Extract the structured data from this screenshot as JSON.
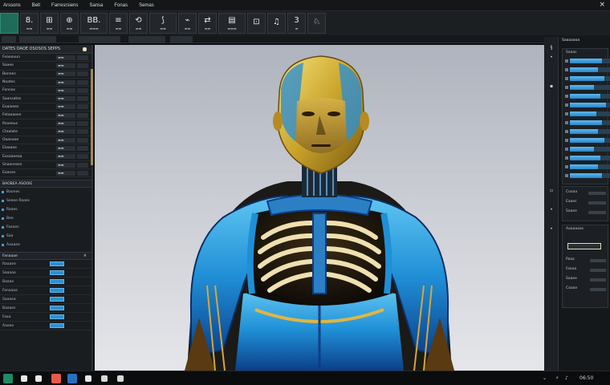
{
  "menubar": {
    "items": [
      "Arssons",
      "Belt",
      "Farresrsiens",
      "Sansa",
      "Fonas",
      "Semas"
    ],
    "close_glyph": "×"
  },
  "toolbar": {
    "tools": [
      {
        "glyph": "",
        "label": "",
        "icon": "app-logo-icon",
        "accent": true
      },
      {
        "glyph": "8.",
        "label": "▬▬",
        "icon": "number-tool-icon"
      },
      {
        "glyph": "⊞",
        "label": "▬▬",
        "icon": "grid-tool-icon"
      },
      {
        "glyph": "⊕",
        "label": "▬▬",
        "icon": "add-object-icon"
      },
      {
        "glyph": "BB.",
        "label": "▬▬▬",
        "icon": "bone-tool-icon",
        "wide": true
      },
      {
        "glyph": "≡",
        "label": "▬▬",
        "icon": "list-tool-icon"
      },
      {
        "glyph": "⟲",
        "label": "▬▬",
        "icon": "rotate-icon"
      },
      {
        "glyph": "⟆",
        "label": "▬▬",
        "icon": "curve-icon",
        "wide": true
      },
      {
        "glyph": "⌁",
        "label": "▬▬",
        "icon": "pen-icon"
      },
      {
        "glyph": "⇄",
        "label": "▬▬",
        "icon": "transfer-icon"
      },
      {
        "glyph": "▤",
        "label": "▬▬▬",
        "icon": "panel-icon",
        "wide": true
      },
      {
        "glyph": "⊡",
        "label": "",
        "icon": "frame-icon"
      },
      {
        "glyph": "♫",
        "label": "",
        "icon": "media-icon"
      },
      {
        "glyph": "3",
        "label": "▬",
        "icon": "three-icon"
      },
      {
        "glyph": "♘",
        "label": "",
        "icon": "figure-icon"
      }
    ]
  },
  "left_panel": {
    "header": "DATES  DAOE  OSOSOS  SEPPS",
    "properties": [
      {
        "name": "Feaoouun",
        "value": "▬▬"
      },
      {
        "name": "Saaee",
        "value": "▬▬"
      },
      {
        "name": "Bonnes",
        "value": "▬▬"
      },
      {
        "name": "Noates",
        "value": "▬▬"
      },
      {
        "name": "Fonnes",
        "value": "▬▬"
      },
      {
        "name": "Saansates",
        "value": "▬▬"
      },
      {
        "name": "Eoaieees",
        "value": "▬▬"
      },
      {
        "name": "Fetaoaoen",
        "value": "▬▬"
      },
      {
        "name": "Rsoeeus",
        "value": "▬▬"
      },
      {
        "name": "Ctaalate",
        "value": "▬▬"
      },
      {
        "name": "Oaaeaoe",
        "value": "▬▬"
      },
      {
        "name": "Elaaaoe",
        "value": "▬▬"
      },
      {
        "name": "Eosaaeeaa",
        "value": "▬▬"
      },
      {
        "name": "Snaoneses",
        "value": "▬▬"
      },
      {
        "name": "Eoanes",
        "value": "▬▬"
      }
    ],
    "section_title": "BAOBEA ASOOIE",
    "sub_items": [
      "Baones",
      "Seeee  Raaes",
      "Raaes",
      "Bee",
      "Faaaes",
      "Saa",
      "Aaaaee"
    ],
    "layers_title": "Fanaaae",
    "layers": [
      "Raaaee",
      "Saaaaa",
      "Baaae",
      "Fanaaaa",
      "Saaaea",
      "Baaaes",
      "Faaa",
      "Aaaee"
    ]
  },
  "right_panel": {
    "title": "Saaaaaoa",
    "top_label": "Saaas",
    "sliders": [
      0.8,
      0.7,
      0.85,
      0.6,
      0.75,
      0.9,
      0.65,
      0.8,
      0.7,
      0.85,
      0.6,
      0.75,
      0.7,
      0.8
    ],
    "section2_labels": [
      "Coaaa",
      "Eaaes",
      "Saaee"
    ],
    "section3_title": "Aaaaaaas",
    "section3_labels": [
      "Paaa",
      "Faaaa",
      "Saaee",
      "Caaae"
    ]
  },
  "taskbar": {
    "tray_text": "⌄",
    "clock": "06:50"
  },
  "colors": {
    "accent": "#1f6b5a",
    "slider_fill": "#3fa0de",
    "layer_chip": "#2f8fd0"
  }
}
